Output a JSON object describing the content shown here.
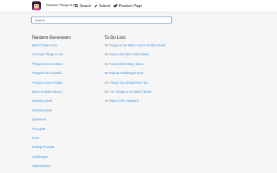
{
  "header": {
    "brand": "Random Things to Do",
    "nav": {
      "search": "Search",
      "submit": "Submit",
      "random_page": "Random Page"
    }
  },
  "search": {
    "placeholder": "Search..."
  },
  "columns": {
    "random_generators": {
      "title": "Random Generators",
      "items": [
        "Best Things to Do",
        "Funniest Things to Do",
        "Things to Do at Home",
        "Things to Do Outside",
        "Things to Do in Public",
        "Ways to Make Money",
        "Drawing Ideas",
        "Painting Ideas",
        "Questions",
        "Thoughts",
        "Puns",
        "Writing Prompts",
        "Challenges",
        "Superpowers"
      ]
    },
    "to_do_lists": {
      "title": "To Do Lists",
      "items": [
        "35 Things to Do When You're Really Bored",
        "25 Funny YouTube Video Ideas",
        "30 Funny Short Story Ideas",
        "26 Easiest Challenges Ever",
        "20 Things You Should NOT Do",
        "29 Fun Things to Do with Friends",
        "15 Ways to Be Awkward"
      ]
    }
  },
  "colors": {
    "link": "#3a8fd9",
    "background": "#f6f6f6",
    "header": "#ffffff"
  }
}
